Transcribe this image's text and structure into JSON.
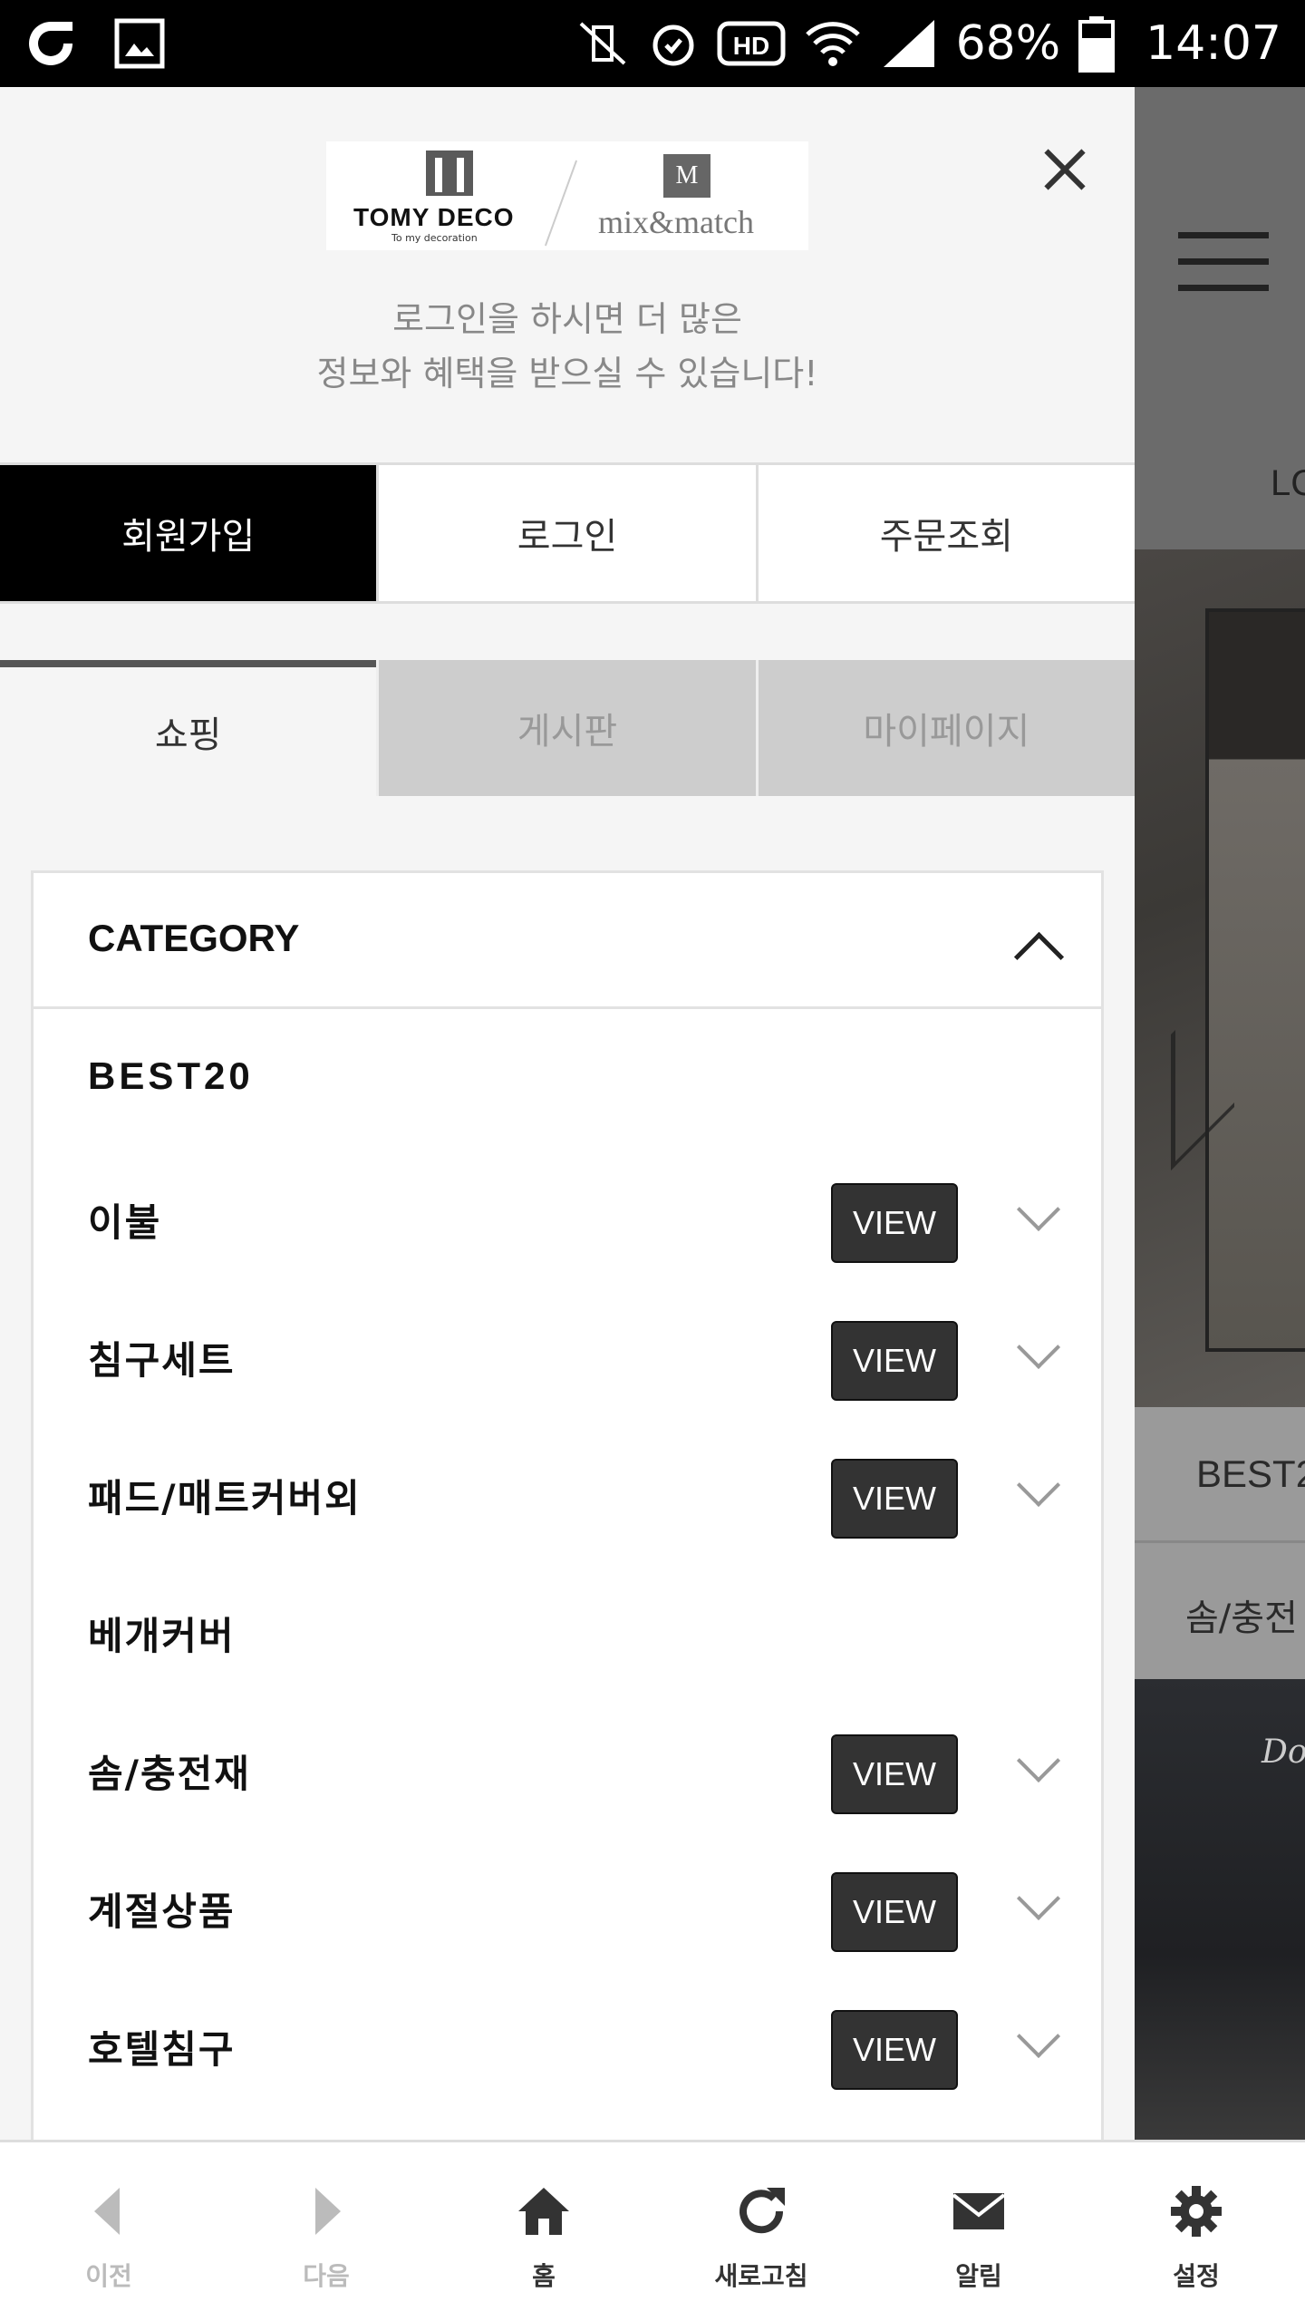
{
  "status_bar": {
    "battery": "68%",
    "time": "14:07"
  },
  "drawer": {
    "logo": {
      "brand1": "TOMY DECO",
      "brand1_tagline": "To my decoration",
      "brand2": "mix&match"
    },
    "login_message_line1": "로그인을 하시면 더 많은",
    "login_message_line2": "정보와 혜택을 받으실 수 있습니다!",
    "account_buttons": [
      "회원가입",
      "로그인",
      "주문조회"
    ],
    "tabs": [
      "쇼핑",
      "게시판",
      "마이페이지"
    ],
    "category": {
      "title": "CATEGORY",
      "items": [
        {
          "label": "BEST20"
        },
        {
          "label": "이불",
          "view": "VIEW"
        },
        {
          "label": "침구세트",
          "view": "VIEW"
        },
        {
          "label": "패드/매트커버외",
          "view": "VIEW"
        },
        {
          "label": "베개커버"
        },
        {
          "label": "솜/충전재",
          "view": "VIEW"
        },
        {
          "label": "계절상품",
          "view": "VIEW"
        },
        {
          "label": "호텔침구",
          "view": "VIEW"
        }
      ]
    }
  },
  "background_page": {
    "header_text": "LC",
    "best_text": "BEST2",
    "som_text": "솜/충전",
    "banner_text": "Do"
  },
  "bottom_nav": [
    "이전",
    "다음",
    "홈",
    "새로고침",
    "알림",
    "설정"
  ]
}
